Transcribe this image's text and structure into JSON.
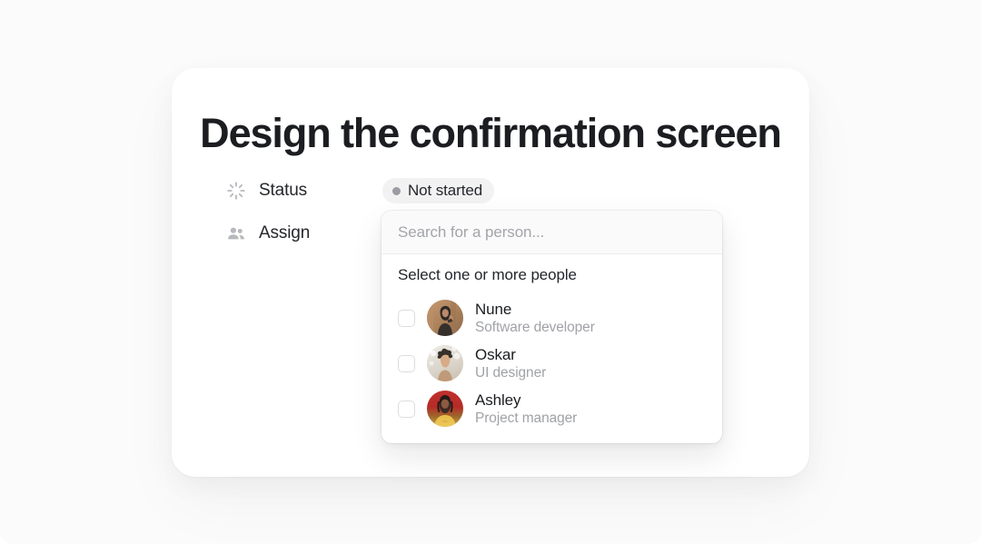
{
  "page": {
    "background_color": "#fbfbfc",
    "card_background": "#ffffff"
  },
  "card": {
    "title": "Design the confirmation screen"
  },
  "properties": [
    {
      "icon": "spinner-icon",
      "label": "Status"
    },
    {
      "icon": "people-icon",
      "label": "Assign"
    }
  ],
  "status": {
    "label": "Status",
    "value": "Not started",
    "dot_color": "#9a9ca1",
    "pill_color": "#f2f2f3"
  },
  "assign": {
    "label": "Assign"
  },
  "picker": {
    "search_placeholder": "Search for a person...",
    "search_value": "",
    "heading": "Select one or more people",
    "people": [
      {
        "name": "Nune",
        "role": "Software developer",
        "checked": false,
        "avatar_colors": [
          "#b08a63",
          "#3b3430"
        ]
      },
      {
        "name": "Oskar",
        "role": "UI designer",
        "checked": false,
        "avatar_colors": [
          "#e6e2dc",
          "#2f2a26"
        ]
      },
      {
        "name": "Ashley",
        "role": "Project manager",
        "checked": false,
        "avatar_colors": [
          "#c42f2c",
          "#e8b23a"
        ]
      }
    ]
  }
}
